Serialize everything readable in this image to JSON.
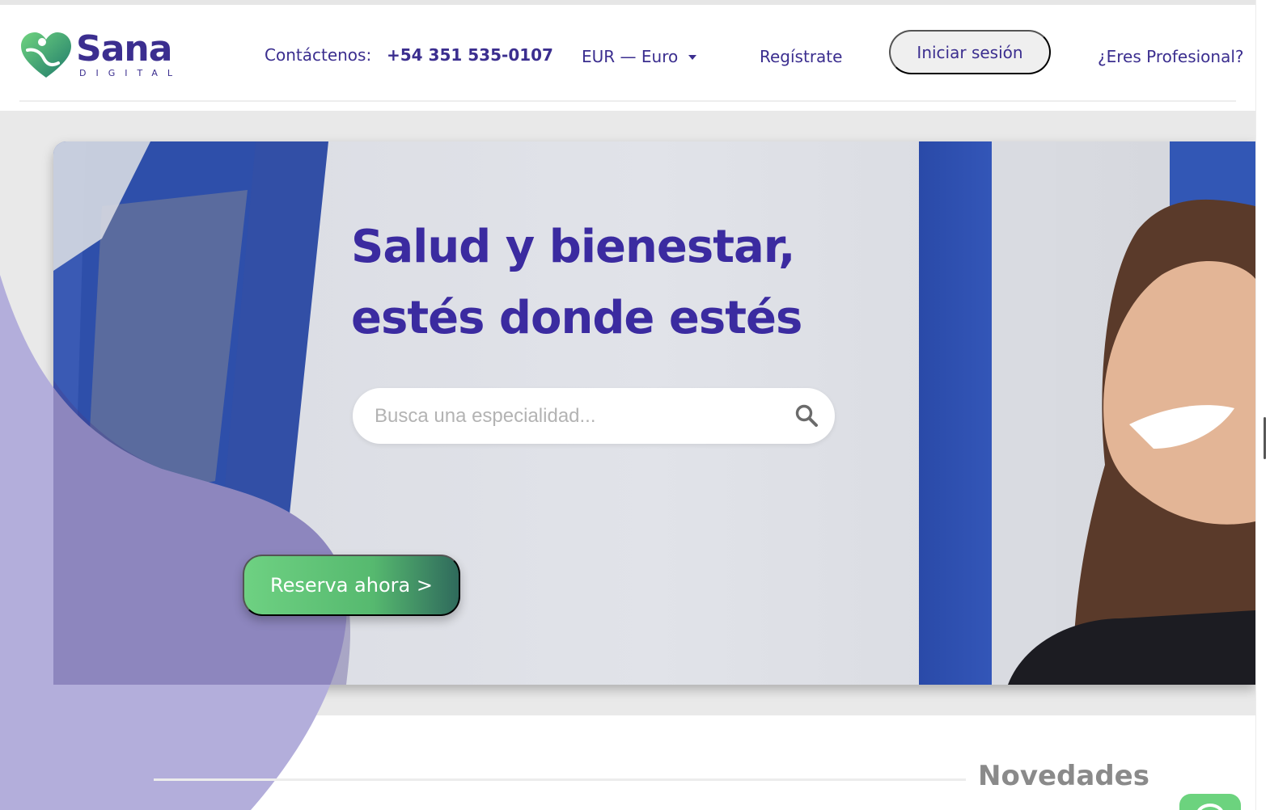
{
  "brand": {
    "name": "Sana",
    "sub": "DIGITAL",
    "primary_color": "#3b2e8f",
    "accent_green": "#5cc36f",
    "blob_color": "#b3aedb"
  },
  "header": {
    "contact_label": "Contáctenos:",
    "contact_phone": "+54 351 535-0107",
    "currency_label": "EUR — Euro",
    "register_label": "Regístrate",
    "login_label": "Iniciar sesión",
    "professional_label": "¿Eres Profesional?"
  },
  "hero": {
    "headline_line1": "Salud y bienestar,",
    "headline_line2": "estés donde estés",
    "search_placeholder": "Busca una especialidad...",
    "cta_label": "Reserva ahora >"
  },
  "news": {
    "title": "Novedades"
  },
  "icons": {
    "search": "search-icon",
    "currency_caret": "caret-down-icon",
    "chat": "chat-icon",
    "logo": "heart-logo-icon"
  }
}
